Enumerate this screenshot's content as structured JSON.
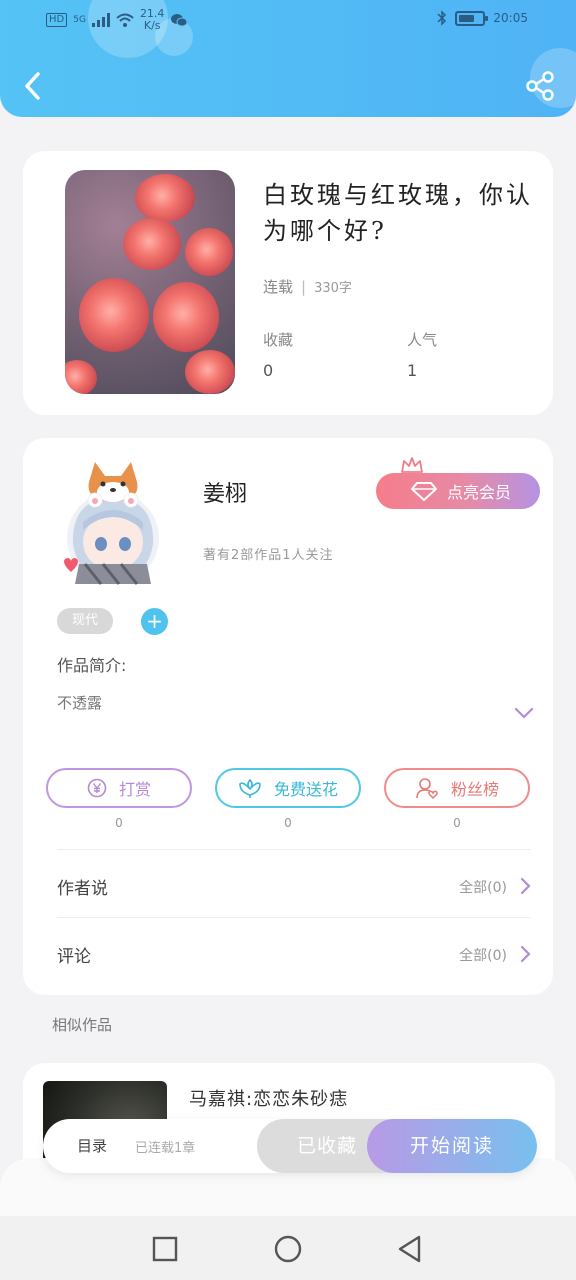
{
  "status_bar": {
    "hd": "HD",
    "network": "5G",
    "speed_value": "21.4",
    "speed_unit": "K/s",
    "time": "20:05",
    "battery_level": 0.7
  },
  "header": {
    "back_icon": "chevron-left-icon",
    "share_icon": "share-icon"
  },
  "book": {
    "title": "白玫瑰与红玫瑰，你认为哪个好?",
    "status": "连载",
    "chapters": "330字",
    "favorites_label": "收藏",
    "favorites_value": "0",
    "popularity_label": "人气",
    "popularity_value": "1"
  },
  "author": {
    "name": "姜栩",
    "stats": "著有2部作品1人关注",
    "vip_label": "点亮会员",
    "tag": "现代",
    "intro_label": "作品简介:",
    "intro_text": "不透露"
  },
  "actions": [
    {
      "label": "打赏",
      "count": "0",
      "icon": "yen-coin-icon"
    },
    {
      "label": "免费送花",
      "count": "0",
      "icon": "flower-icon"
    },
    {
      "label": "粉丝榜",
      "count": "0",
      "icon": "user-heart-icon"
    }
  ],
  "rows": [
    {
      "label": "作者说",
      "right": "全部(0)"
    },
    {
      "label": "评论",
      "right": "全部(0)"
    }
  ],
  "similar": {
    "title": "相似作品",
    "items": [
      {
        "name": "马嘉祺:恋恋朱砂痣"
      }
    ]
  },
  "bottom_bar": {
    "toc": "目录",
    "progress": "已连载1章",
    "collected": "已收藏",
    "read": "开始阅读"
  },
  "colors": {
    "header": "#55c3f5",
    "accent_blue": "#4fc2ee",
    "vip_gradient_start": "#f57d8a",
    "vip_gradient_end": "#b493e3"
  }
}
